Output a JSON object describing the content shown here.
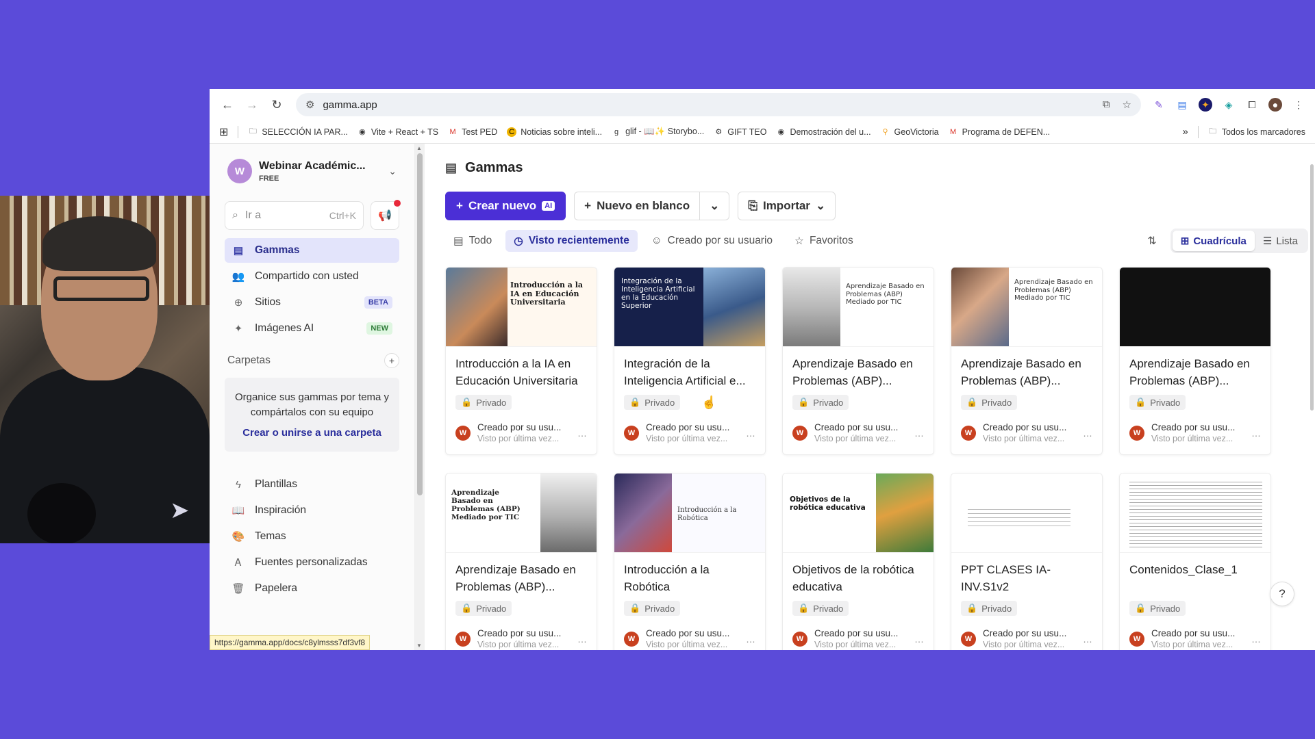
{
  "browser": {
    "url": "gamma.app",
    "status_url": "https://gamma.app/docs/c8ylmsss7df3vf8",
    "bookmarks": [
      "SELECCIÓN IA PAR...",
      "Vite + React + TS",
      "Test PED",
      "Noticias sobre inteli...",
      "glif - 📖✨ Storybo...",
      "GIFT TEO",
      "Demostración del u...",
      "GeoVictoria",
      "Programa de DEFEN..."
    ],
    "all_bookmarks": "Todos los marcadores"
  },
  "workspace": {
    "name": "Webinar Académic...",
    "plan": "FREE",
    "avatar": "W"
  },
  "search": {
    "placeholder": "Ir a",
    "shortcut": "Ctrl+K"
  },
  "nav": [
    {
      "label": "Gammas"
    },
    {
      "label": "Compartido con usted"
    },
    {
      "label": "Sitios",
      "badge": "BETA"
    },
    {
      "label": "Imágenes AI",
      "badge": "NEW"
    }
  ],
  "folders": {
    "title": "Carpetas",
    "hint": "Organice sus gammas por tema y compártalos con su equipo",
    "link": "Crear o unirse a una carpeta"
  },
  "nav2": [
    {
      "label": "Plantillas"
    },
    {
      "label": "Inspiración"
    },
    {
      "label": "Temas"
    },
    {
      "label": "Fuentes personalizadas"
    },
    {
      "label": "Papelera"
    }
  ],
  "main": {
    "title": "Gammas",
    "btn_create": "Crear nuevo",
    "ai_tag": "AI",
    "btn_blank": "Nuevo en blanco",
    "btn_import": "Importar",
    "filters": [
      "Todo",
      "Visto recientemente",
      "Creado por su usuario",
      "Favoritos"
    ],
    "view_grid": "Cuadrícula",
    "view_list": "Lista"
  },
  "cards": [
    {
      "title": "Introducción a la IA en Educación Universitaria",
      "thumb": "Introducción a la IA en Educación Universitaria"
    },
    {
      "title": "Integración de la Inteligencia Artificial e...",
      "thumb": "Integración de la Inteligencia Artificial en la Educación Superior"
    },
    {
      "title": "Aprendizaje Basado en Problemas (ABP)...",
      "thumb": "Aprendizaje Basado en Problemas (ABP) Mediado por TIC"
    },
    {
      "title": "Aprendizaje Basado en Problemas (ABP)...",
      "thumb": "Aprendizaje Basado en Problemas (ABP) Mediado por TIC"
    },
    {
      "title": "Aprendizaje Basado en Problemas (ABP)...",
      "thumb": ""
    },
    {
      "title": "Aprendizaje Basado en Problemas (ABP)...",
      "thumb": "Aprendizaje Basado en Problemas (ABP) Mediado por TIC"
    },
    {
      "title": "Introducción a la Robótica",
      "thumb": "Introducción a la Robótica"
    },
    {
      "title": "Objetivos de la robótica educativa",
      "thumb": "Objetivos de la robótica educativa"
    },
    {
      "title": "PPT CLASES IA-INV.S1v2",
      "thumb": ""
    },
    {
      "title": "Contenidos_Clase_1",
      "thumb": ""
    }
  ],
  "card_meta": {
    "private": "Privado",
    "creator": "Creado por su usu...",
    "viewed": "Visto por última vez...",
    "avatar": "W"
  },
  "help": "?",
  "colors": {
    "brand": "#4b2fd6",
    "background": "#5b4bd9",
    "active_nav": "#e3e4fb"
  }
}
